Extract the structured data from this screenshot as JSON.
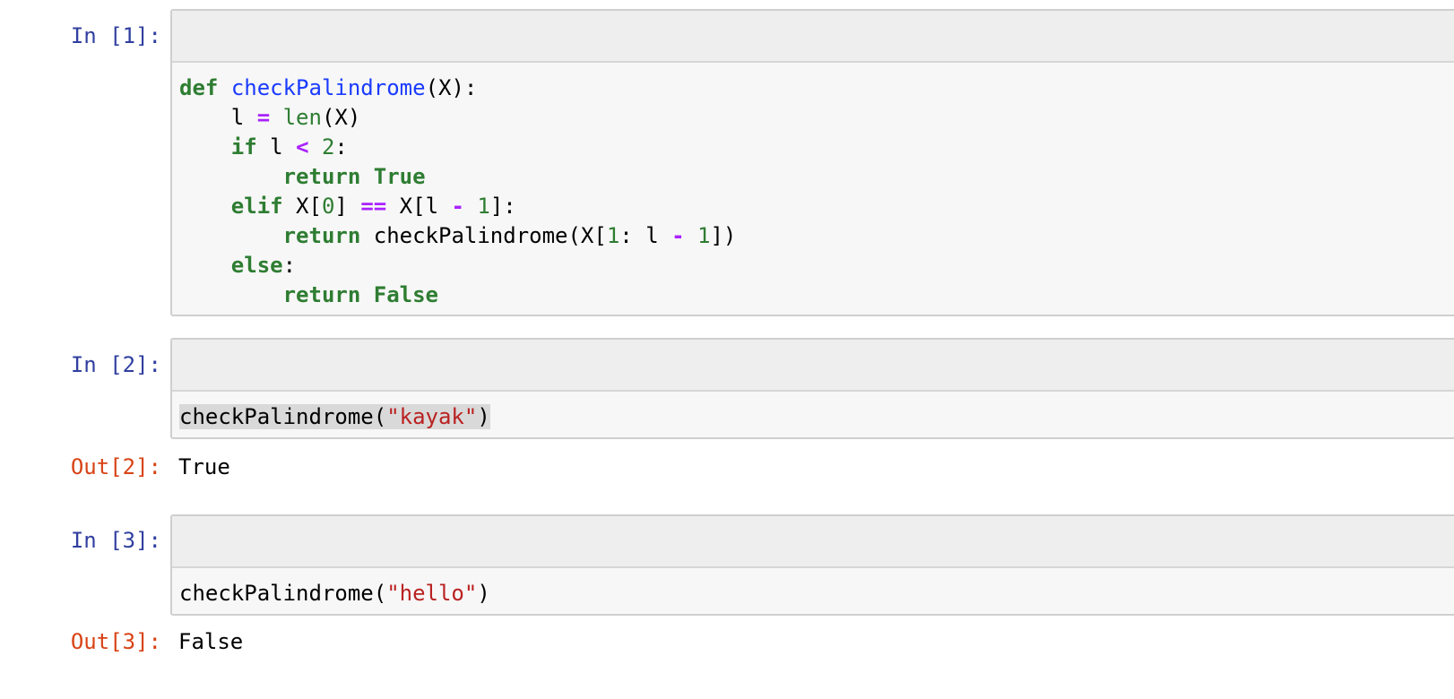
{
  "cells": [
    {
      "in_prompt": "In [1]:",
      "code": [
        [
          {
            "t": "def",
            "c": "k"
          },
          {
            "t": " ",
            "c": "p"
          },
          {
            "t": "checkPalindrome",
            "c": "f"
          },
          {
            "t": "(X):",
            "c": "p"
          }
        ],
        [
          {
            "t": "    l ",
            "c": "p"
          },
          {
            "t": "=",
            "c": "o"
          },
          {
            "t": " ",
            "c": "p"
          },
          {
            "t": "len",
            "c": "b"
          },
          {
            "t": "(X)",
            "c": "p"
          }
        ],
        [
          {
            "t": "    ",
            "c": "p"
          },
          {
            "t": "if",
            "c": "k"
          },
          {
            "t": " l ",
            "c": "p"
          },
          {
            "t": "<",
            "c": "o"
          },
          {
            "t": " ",
            "c": "p"
          },
          {
            "t": "2",
            "c": "n"
          },
          {
            "t": ":",
            "c": "p"
          }
        ],
        [
          {
            "t": "        ",
            "c": "p"
          },
          {
            "t": "return",
            "c": "k"
          },
          {
            "t": " ",
            "c": "p"
          },
          {
            "t": "True",
            "c": "k"
          }
        ],
        [
          {
            "t": "    ",
            "c": "p"
          },
          {
            "t": "elif",
            "c": "k"
          },
          {
            "t": " X[",
            "c": "p"
          },
          {
            "t": "0",
            "c": "n"
          },
          {
            "t": "] ",
            "c": "p"
          },
          {
            "t": "==",
            "c": "o"
          },
          {
            "t": " X[l ",
            "c": "p"
          },
          {
            "t": "-",
            "c": "o"
          },
          {
            "t": " ",
            "c": "p"
          },
          {
            "t": "1",
            "c": "n"
          },
          {
            "t": "]:",
            "c": "p"
          }
        ],
        [
          {
            "t": "        ",
            "c": "p"
          },
          {
            "t": "return",
            "c": "k"
          },
          {
            "t": " checkPalindrome(X[",
            "c": "p"
          },
          {
            "t": "1",
            "c": "n"
          },
          {
            "t": ": l ",
            "c": "p"
          },
          {
            "t": "-",
            "c": "o"
          },
          {
            "t": " ",
            "c": "p"
          },
          {
            "t": "1",
            "c": "n"
          },
          {
            "t": "])",
            "c": "p"
          }
        ],
        [
          {
            "t": "    ",
            "c": "p"
          },
          {
            "t": "else",
            "c": "k"
          },
          {
            "t": ":",
            "c": "p"
          }
        ],
        [
          {
            "t": "        ",
            "c": "p"
          },
          {
            "t": "return",
            "c": "k"
          },
          {
            "t": " ",
            "c": "p"
          },
          {
            "t": "False",
            "c": "k"
          }
        ]
      ]
    },
    {
      "in_prompt": "In [2]:",
      "code": [
        [
          {
            "t": "checkPalindrome(",
            "c": "p"
          },
          {
            "t": "\"kayak\"",
            "c": "s"
          },
          {
            "t": ")",
            "c": "p"
          }
        ]
      ],
      "out_prompt": "Out[2]:",
      "output": "True"
    },
    {
      "in_prompt": "In [3]:",
      "code": [
        [
          {
            "t": "checkPalindrome(",
            "c": "p"
          },
          {
            "t": "\"hello\"",
            "c": "s"
          },
          {
            "t": ")",
            "c": "p"
          }
        ]
      ],
      "out_prompt": "Out[3]:",
      "output": "False"
    }
  ]
}
